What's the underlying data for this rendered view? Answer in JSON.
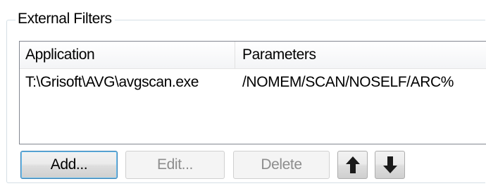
{
  "group": {
    "title": "External Filters"
  },
  "list": {
    "columns": [
      "Application",
      "Parameters"
    ],
    "rows": [
      {
        "application": "T:\\Grisoft\\AVG\\avgscan.exe",
        "parameters": "/NOMEM/SCAN/NOSELF/ARC%"
      }
    ]
  },
  "buttons": {
    "add": "Add...",
    "edit": "Edit...",
    "delete": "Delete",
    "move_up_icon": "arrow-up-icon",
    "move_down_icon": "arrow-down-icon"
  },
  "colors": {
    "default_button_border": "#3c7fb1",
    "disabled_text": "#8d8d8d"
  }
}
